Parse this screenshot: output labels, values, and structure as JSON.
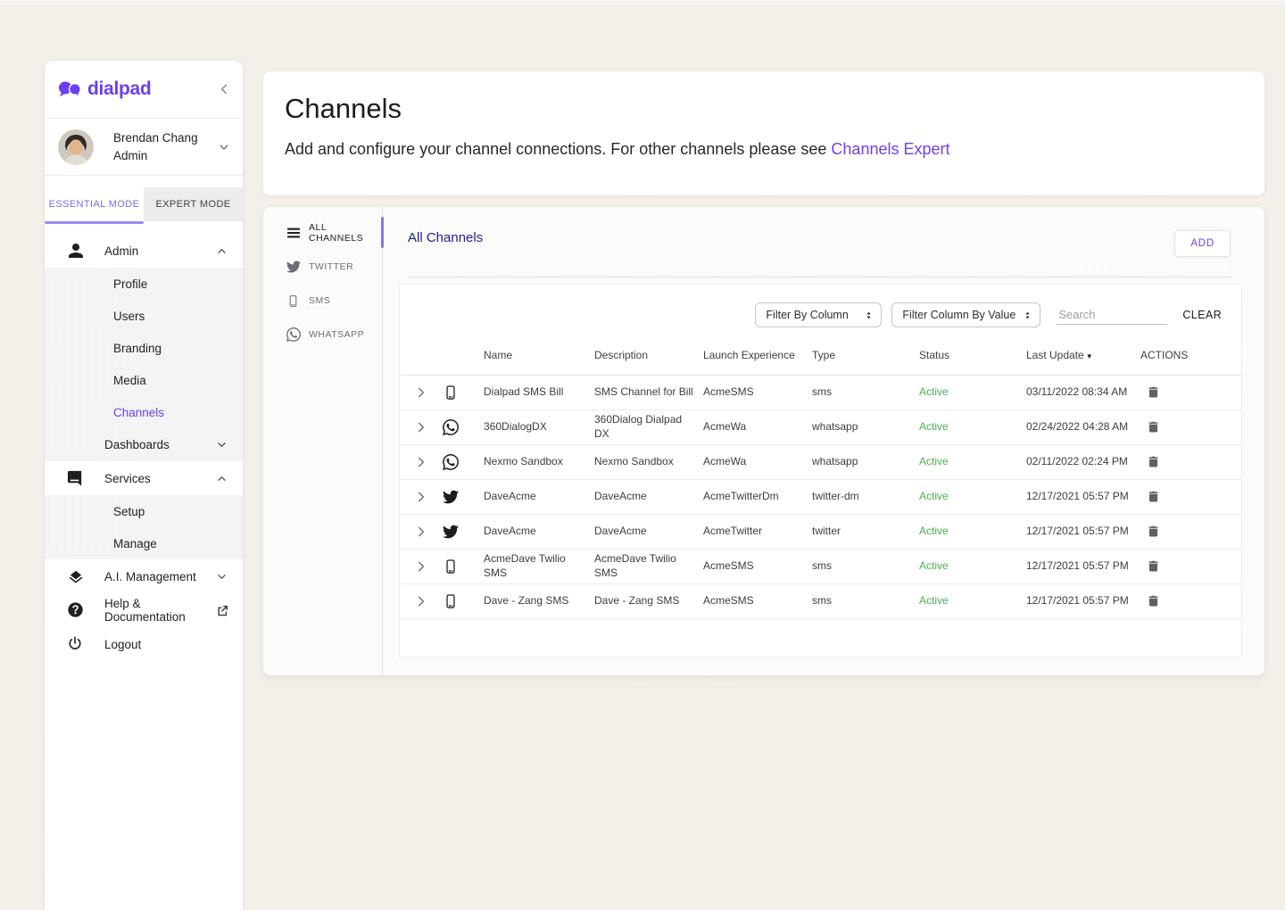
{
  "sidebar": {
    "logo_text": "dialpad",
    "user": {
      "name": "Brendan Chang",
      "role": "Admin"
    },
    "mode_tabs": {
      "essential": "ESSENTIAL MODE",
      "expert": "EXPERT MODE"
    },
    "nav": {
      "admin": "Admin",
      "profile": "Profile",
      "users": "Users",
      "branding": "Branding",
      "media": "Media",
      "channels": "Channels",
      "dashboards": "Dashboards",
      "services": "Services",
      "setup": "Setup",
      "manage": "Manage",
      "ai": "A.I. Management",
      "help": "Help & Documentation",
      "logout": "Logout"
    }
  },
  "header": {
    "title": "Channels",
    "subtitle": "Add and configure your channel connections. For other channels please see",
    "link_text": "Channels Expert"
  },
  "panel": {
    "tabs": {
      "all": "ALL CHANNELS",
      "twitter": "TWITTER",
      "sms": "SMS",
      "whatsapp": "WHATSAPP"
    },
    "heading": "All Channels",
    "add_button": "ADD",
    "filters": {
      "column": "Filter By Column",
      "value": "Filter Column By Value",
      "search_placeholder": "Search",
      "clear": "CLEAR"
    },
    "table": {
      "headers": {
        "name": "Name",
        "description": "Description",
        "launch": "Launch Experience",
        "type": "Type",
        "status": "Status",
        "updated": "Last Update",
        "sort_indicator": "▼",
        "actions": "ACTIONS"
      },
      "rows": [
        {
          "icon": "sms-phone",
          "name": "Dialpad SMS Bill",
          "description": "SMS Channel for Bill",
          "launch": "AcmeSMS",
          "type": "sms",
          "status": "Active",
          "updated": "03/11/2022 08:34 AM"
        },
        {
          "icon": "whatsapp",
          "name": "360DialogDX",
          "description": "360Dialog Dialpad DX",
          "launch": "AcmeWa",
          "type": "whatsapp",
          "status": "Active",
          "updated": "02/24/2022 04:28 AM"
        },
        {
          "icon": "whatsapp",
          "name": "Nexmo Sandbox",
          "description": "Nexmo Sandbox",
          "launch": "AcmeWa",
          "type": "whatsapp",
          "status": "Active",
          "updated": "02/11/2022 02:24 PM"
        },
        {
          "icon": "twitter",
          "name": "DaveAcme",
          "description": "DaveAcme",
          "launch": "AcmeTwitterDm",
          "type": "twitter-dm",
          "status": "Active",
          "updated": "12/17/2021 05:57 PM"
        },
        {
          "icon": "twitter",
          "name": "DaveAcme",
          "description": "DaveAcme",
          "launch": "AcmeTwitter",
          "type": "twitter",
          "status": "Active",
          "updated": "12/17/2021 05:57 PM"
        },
        {
          "icon": "sms-phone",
          "name": "AcmeDave Twilio SMS",
          "description": "AcmeDave Twilio SMS",
          "launch": "AcmeSMS",
          "type": "sms",
          "status": "Active",
          "updated": "12/17/2021 05:57 PM"
        },
        {
          "icon": "sms-phone",
          "name": "Dave - Zang SMS",
          "description": "Dave - Zang SMS",
          "launch": "AcmeSMS",
          "type": "sms",
          "status": "Active",
          "updated": "12/17/2021 05:57 PM"
        }
      ]
    }
  },
  "colors": {
    "brand_purple": "#6C3EF5",
    "active_green": "#4caf50",
    "heading_navy": "#23218a"
  }
}
